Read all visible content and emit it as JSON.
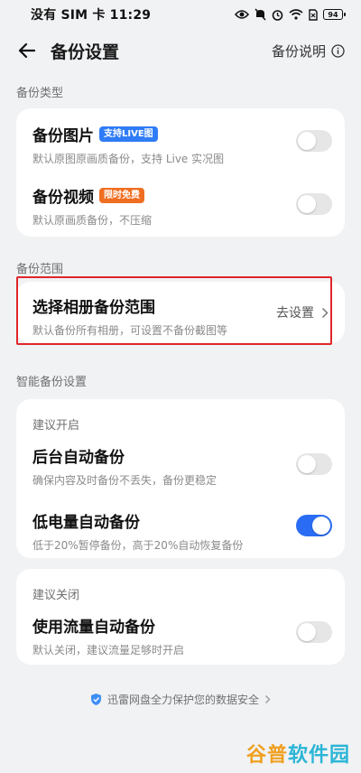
{
  "status_bar": {
    "carrier_time": "没有 SIM 卡 11:29",
    "battery": "94"
  },
  "header": {
    "title": "备份设置",
    "help_label": "备份说明"
  },
  "backup_type": {
    "section_label": "备份类型",
    "photos": {
      "title": "备份图片",
      "badge": "支持LIVE图",
      "subtitle": "默认原图原画质备份，支持 Live 实况图",
      "enabled": false
    },
    "videos": {
      "title": "备份视频",
      "badge": "限时免费",
      "subtitle": "默认原画质备份，不压缩",
      "enabled": false
    }
  },
  "backup_range": {
    "section_label": "备份范围",
    "title": "选择相册备份范围",
    "subtitle": "默认备份所有相册，可设置不备份截图等",
    "action_label": "去设置"
  },
  "smart_backup": {
    "section_label": "智能备份设置",
    "recommended_on": {
      "group_label": "建议开启",
      "background": {
        "title": "后台自动备份",
        "subtitle": "确保内容及时备份不丢失，备份更稳定",
        "enabled": false
      },
      "low_battery": {
        "title": "低电量自动备份",
        "subtitle": "低于20%暂停备份，高于20%自动恢复备份",
        "enabled": true
      }
    },
    "recommended_off": {
      "group_label": "建议关闭",
      "cellular": {
        "title": "使用流量自动备份",
        "subtitle": "默认关闭，建议流量足够时开启",
        "enabled": false
      }
    }
  },
  "footer": {
    "security_note": "迅雷网盘全力保护您的数据安全"
  },
  "watermark": {
    "text_a": "谷普",
    "text_b": "软件园"
  },
  "colors": {
    "accent": "#2a6df4",
    "highlight_border": "#e0262a",
    "badge_blue": "#2f7cf6",
    "badge_orange": "#f06e22"
  }
}
